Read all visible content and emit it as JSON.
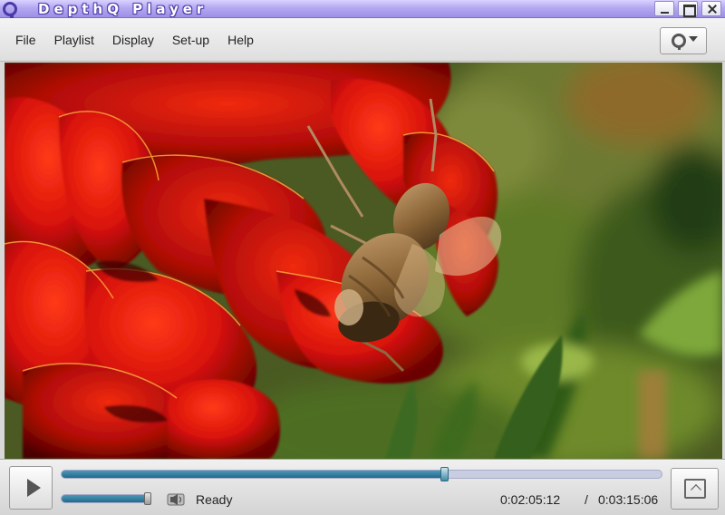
{
  "window": {
    "title": "DepthQ Player",
    "logo_icon": "depthq-q-logo-icon",
    "buttons": [
      "minimize-icon",
      "maximize-icon",
      "close-icon"
    ],
    "accent_color": "#9d8fe6"
  },
  "menu": {
    "items": [
      {
        "label": "File"
      },
      {
        "label": "Playlist"
      },
      {
        "label": "Display"
      },
      {
        "label": "Set-up"
      },
      {
        "label": "Help"
      }
    ],
    "logo_button_icon": "depthq-logo-dropdown-icon"
  },
  "video": {
    "content": "red-flower-with-bee-frame"
  },
  "controls": {
    "play_icon": "play-icon",
    "seek_progress": 0.637,
    "volume_level": 0.97,
    "speaker_icon": "speaker-icon",
    "status": "Ready",
    "time_current": "0:02:05:12",
    "time_separator": "/",
    "time_total": "0:03:15:06",
    "fullscreen_icon": "fullscreen-icon",
    "track_color": "#1f6b8c"
  }
}
